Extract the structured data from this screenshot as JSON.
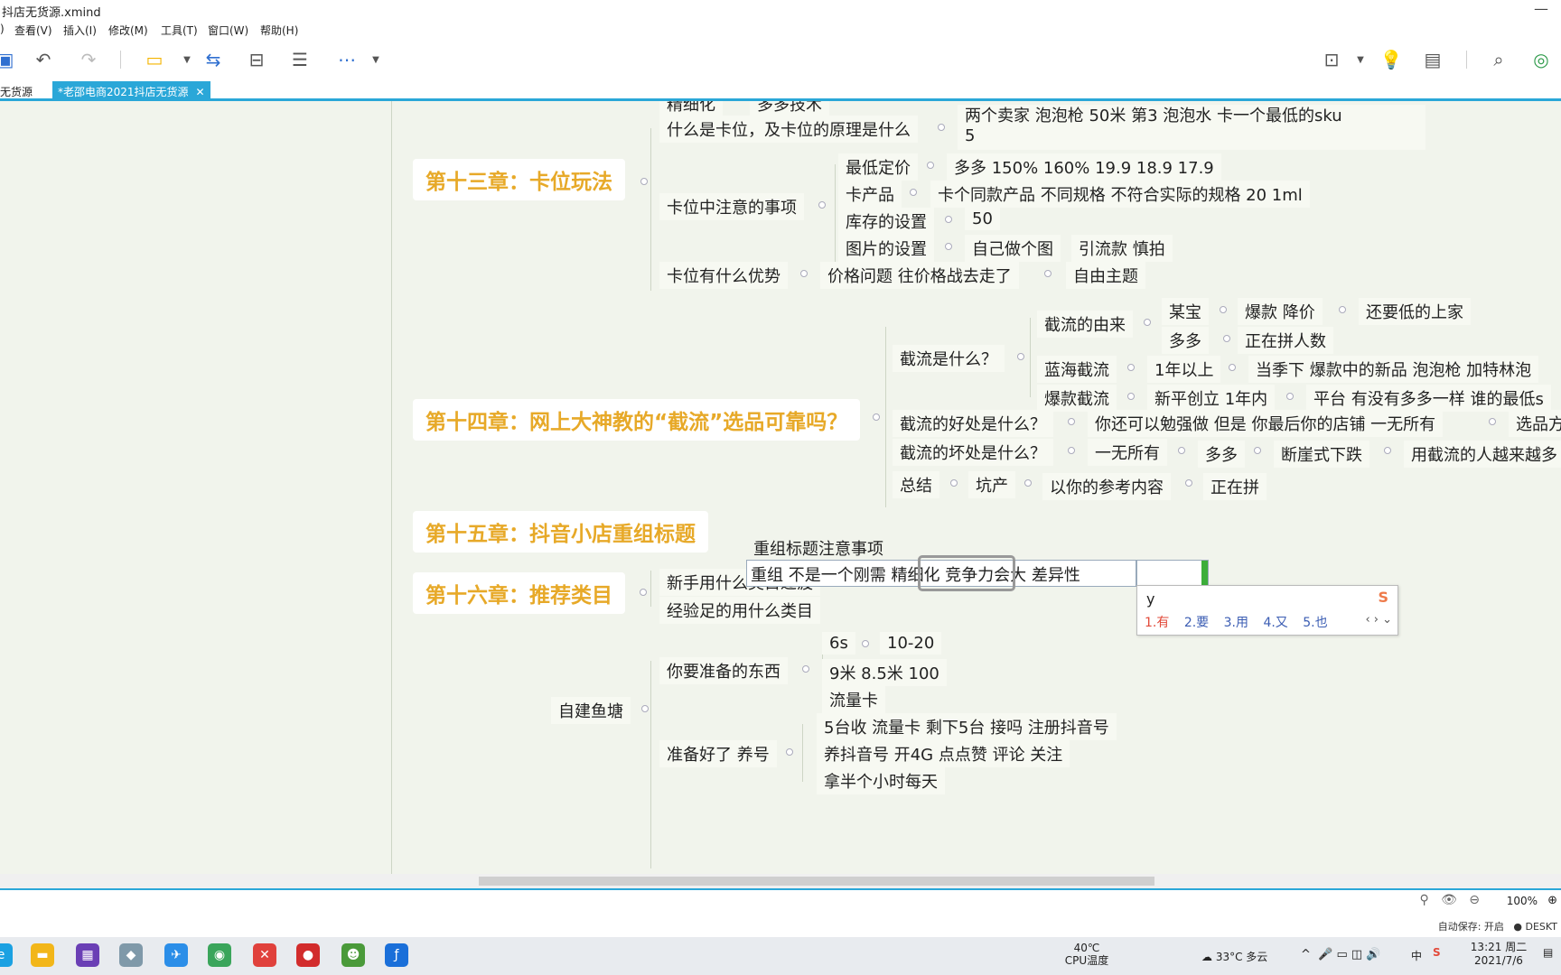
{
  "window": {
    "title": "抖店无货源.xmind"
  },
  "menu": [
    "查看(V)",
    "插入(I)",
    "修改(M)",
    "工具(T)",
    "窗口(W)",
    "帮助(H)"
  ],
  "tabs": [
    "无货源",
    "*老邵电商2021抖店无货源"
  ],
  "tab_close": "✕",
  "canvas": {
    "top_partial": [
      "精细化",
      "多多技术"
    ],
    "ch13": {
      "title": "第十三章：卡位玩法",
      "q1": "什么是卡位，及卡位的原理是什么",
      "a1_line1": "两个卖家  泡泡枪  50米  第3   泡泡水  卡一个最低的sku",
      "a1_line2": "5",
      "q2": "卡位中注意的事项",
      "price": "最低定价",
      "price_val": "多多  150%  160%    19.9  18.9  17.9",
      "prod": "卡产品",
      "prod_val": "卡个同款产品  不同规格  不符合实际的规格  20  1ml",
      "stock": "库存的设置",
      "stock_val": "50",
      "img": "图片的设置",
      "img_val": "自己做个图",
      "img_val2": "引流款 慎拍",
      "q3": "卡位有什么优势",
      "adv": "价格问题   往价格战去走了",
      "adv2": "自由主题"
    },
    "ch14": {
      "title": "第十四章：网上大神教的“截流”选品可靠吗？",
      "what": "截流是什么？",
      "origin": "截流的由来",
      "mou": "某宝",
      "baokuan": "爆款  降价",
      "lower": "还要低的上家",
      "duo": "多多",
      "pin": "正在拼人数",
      "blue": "蓝海截流",
      "blue1": "1年以上",
      "blue2": "当季下  爆款中的新品   泡泡枪   加特林泡",
      "hot": "爆款截流",
      "hot1": "新平创立 1年内",
      "hot2": "平台  有没有多多一样   谁的最低s",
      "good": "截流的好处是什么？",
      "good1": "你还可以勉强做   但是   你最后你的店铺   一无所有",
      "good2": "选品方",
      "bad": "截流的坏处是什么？",
      "bad1": "一无所有",
      "bad2": "多多",
      "bad3": "断崖式下跌",
      "bad4": "用截流的人越来越多",
      "sum": "总结",
      "sum1": "坑产",
      "sum2": "以你的参考内容",
      "sum3": "正在拼"
    },
    "ch15": {
      "title": "第十五章：抖音小店重组标题",
      "editing": "重组  不是一个刚需   精细化  竞争力会大    差异性",
      "note": "重组标题注意事项"
    },
    "ch16": {
      "title": "第十六章：推荐类目",
      "a": "新手用什么类目过渡",
      "b": "经验足的用什么类目"
    },
    "pond": {
      "root": "自建鱼塘",
      "prep": "你要准备的东西",
      "p1": "6s",
      "p1v": "10-20",
      "p2": "9米  8.5米  100",
      "p3": "流量卡",
      "ready": "准备好了  养号",
      "r1": "5台收   流量卡   剩下5台   接吗   注册抖音号",
      "r2": "养抖音号   开4G   点点赞 评论   关注",
      "r3": "拿半个小时每天"
    }
  },
  "ime": {
    "typed": "y",
    "candidates": [
      "1.有",
      "2.要",
      "3.用",
      "4.又",
      "5.也"
    ]
  },
  "status": {
    "zoom": "100%",
    "autosave": "自动保存: 开启",
    "host": "DESKT"
  },
  "taskbar": {
    "temp": "40℃",
    "temp_label": "CPU温度",
    "weather": "33°C  多云",
    "ime_lang": "中",
    "time": "13:21 周二",
    "date": "2021/7/6"
  }
}
